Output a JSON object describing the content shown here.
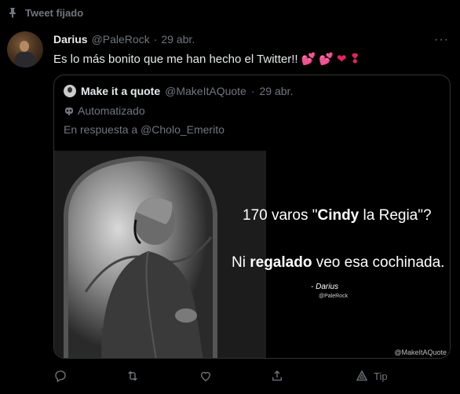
{
  "pinned": {
    "label": "Tweet fijado",
    "icon": "pin-icon"
  },
  "tweet": {
    "author_name": "Darius",
    "author_handle": "@PaleRock",
    "separator": "·",
    "date": "29 abr.",
    "text": "Es lo más bonito que me han hecho el Twitter!!",
    "more_icon": "more-horizontal-icon"
  },
  "quote": {
    "author_name": "Make it a quote",
    "author_handle": "@MakeItAQuote",
    "separator": "·",
    "date": "29 abr.",
    "automated_label": "Automatizado",
    "reply_text": "En respuesta a @Cholo_Emerito",
    "image": {
      "line1_pre": "170 varos \"",
      "line1_bold": "Cindy",
      "line1_post": " la Regia\"?",
      "line2_pre": "Ni ",
      "line2_bold": "regalado",
      "line2_post": " veo esa cochinada.",
      "author": "- Darius",
      "author_handle": "@PaleRock",
      "credit": "@MakeItAQuote"
    }
  },
  "actions": {
    "reply_icon": "reply-icon",
    "retweet_icon": "retweet-icon",
    "like_icon": "heart-icon",
    "share_icon": "share-icon",
    "tip_icon": "tip-icon",
    "tip_label": "Tip"
  },
  "colors": {
    "background": "#000000",
    "text_primary": "#e7e9ea",
    "text_secondary": "#71767b",
    "border": "#2f3336",
    "heart": "#f91880"
  }
}
